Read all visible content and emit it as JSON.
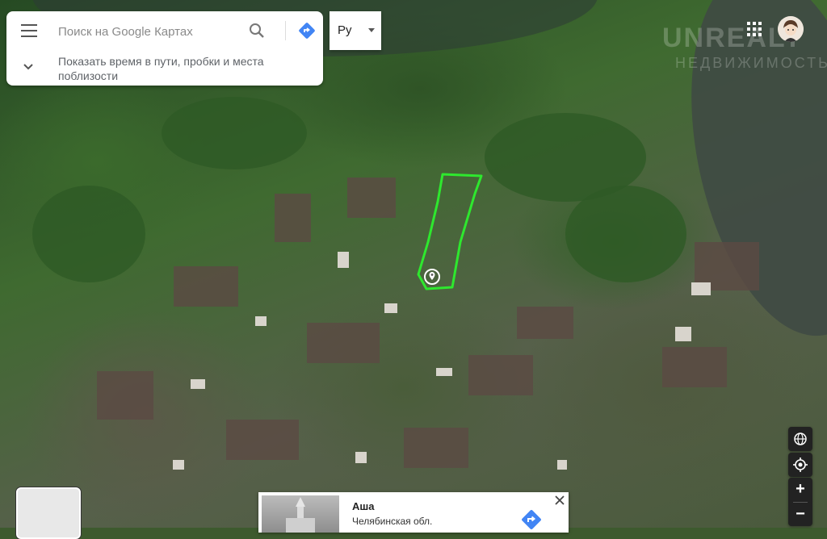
{
  "search": {
    "placeholder": "Поиск на Google Картах",
    "hint": "Показать время в пути, пробки и места поблизости"
  },
  "language": {
    "selected": "Ру"
  },
  "watermark": {
    "brand": "UNREALT",
    "sub": "НЕДВИЖИМОСТЬ"
  },
  "place_card": {
    "title": "Аша",
    "subtitle": "Челябинская обл."
  },
  "zoom": {
    "in_label": "+",
    "out_label": "−"
  },
  "colors": {
    "boundary": "#2ee82e",
    "directions": "#4285f4",
    "control_bg": "#222222"
  },
  "icons": [
    "menu-icon",
    "search-icon",
    "directions-icon",
    "chevron-down-icon",
    "apps-icon",
    "avatar",
    "location-pin-icon",
    "globe-icon",
    "my-location-icon",
    "close-icon"
  ]
}
